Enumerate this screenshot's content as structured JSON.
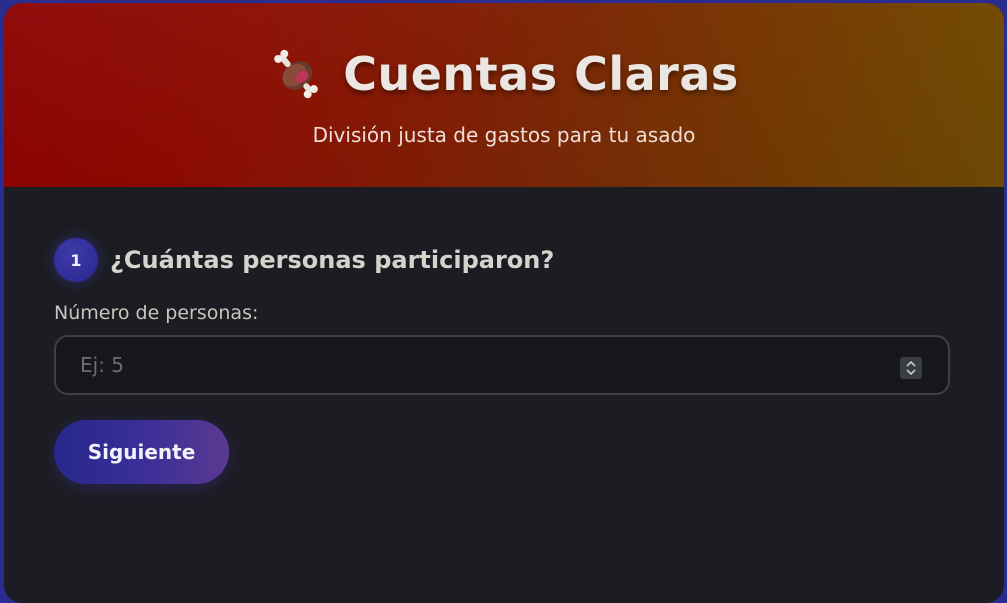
{
  "header": {
    "icon": "meat-on-bone-icon",
    "title": "Cuentas Claras",
    "subtitle": "División justa de gastos para tu asado"
  },
  "step": {
    "number": "1",
    "title": "¿Cuántas personas participaron?"
  },
  "form": {
    "label": "Número de personas:",
    "placeholder": "Ej: 5",
    "value": ""
  },
  "actions": {
    "next_label": "Siguiente"
  },
  "colors": {
    "header_gradient_start": "#8a0000",
    "header_gradient_end": "#7a5304",
    "card_background": "#1c1d22",
    "page_background": "#2a2d8f",
    "button_gradient_start": "#26288c",
    "button_gradient_end": "#5a3a92"
  }
}
